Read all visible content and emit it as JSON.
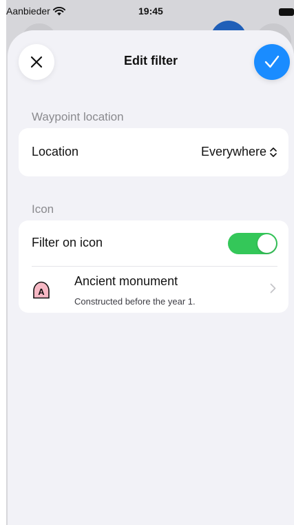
{
  "status_bar": {
    "carrier": "Aanbieder",
    "time": "19:45"
  },
  "header": {
    "title": "Edit filter",
    "close_icon": "close-icon",
    "confirm_icon": "checkmark-icon"
  },
  "sections": {
    "waypoint_location": {
      "header": "Waypoint location",
      "location_label": "Location",
      "location_value": "Everywhere"
    },
    "icon": {
      "header": "Icon",
      "filter_label": "Filter on icon",
      "filter_enabled": true,
      "item_title": "Ancient monument",
      "item_subtitle": "Constructed before the year 1.",
      "item_icon_letter": "A"
    }
  },
  "colors": {
    "accent": "#1a8cff",
    "toggle_on": "#34c759",
    "sheet_bg": "#f2f2f7"
  }
}
